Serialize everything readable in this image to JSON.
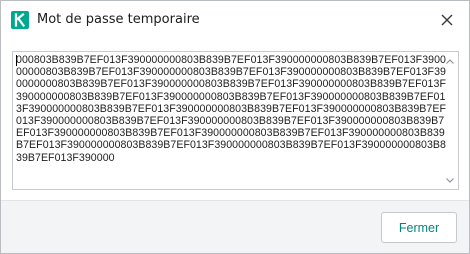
{
  "window": {
    "title": "Mot de passe temporaire",
    "logo": "kaspersky-k-logo",
    "close_icon": "close-icon"
  },
  "password_field": {
    "lines": [
      "000803B839B7EF013F390000000803B839B7EF013F390000000803B839B7EF013F3900",
      "00000803B839B7EF013F390000000803B839B7EF013F390000000803B839B7EF013F39",
      "0000000803B839B7EF013F390000000803B839B7EF013F390000000803B839B7EF013F",
      "390000000803B839B7EF013F390000000803B839B7EF013F390000000803B839B7EF01",
      "3F390000000803B839B7EF013F390000000803B839B7EF013F390000000803B839B7EF",
      "013F390000000803B839B7EF013F390000000803B839B7EF013F390000000803B839B7",
      "EF013F390000000803B839B7EF013F390000000803B839B7EF013F390000000803B839",
      "B7EF013F390000000803B839B7EF013F390000000803B839B7EF013F390000000803B8",
      "39B7EF013F390000"
    ]
  },
  "footer": {
    "close_label": "Fermer"
  },
  "colors": {
    "accent": "#00857b",
    "logo_green": "#00a88e",
    "footer_bg": "#f3f4f5"
  }
}
